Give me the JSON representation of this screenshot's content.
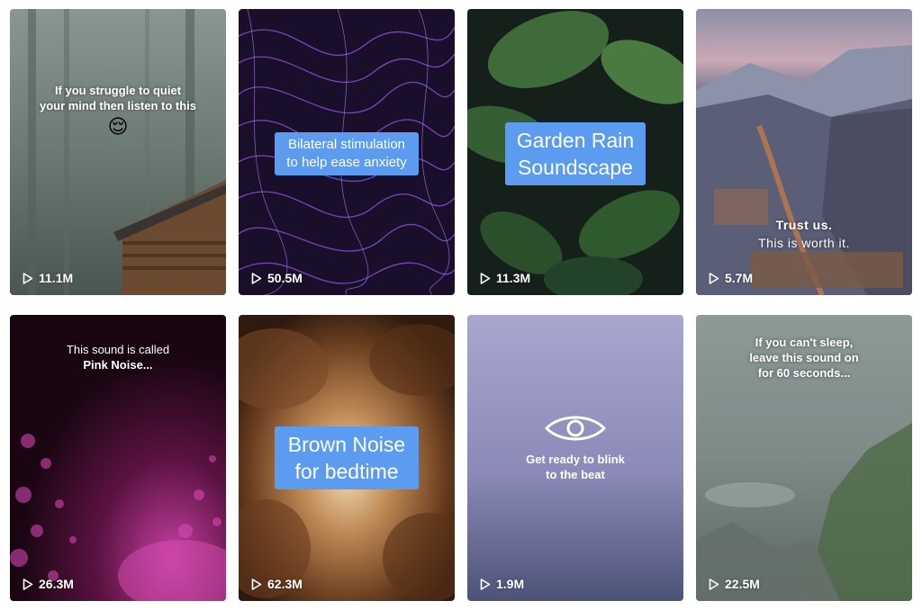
{
  "videos": [
    {
      "views": "11.1M",
      "caption": [
        "If you struggle to quiet",
        "your mind then listen to this"
      ],
      "emoji": "😌"
    },
    {
      "views": "50.5M",
      "caption": [
        "Bilateral stimulation",
        "to help ease anxiety"
      ]
    },
    {
      "views": "11.3M",
      "caption": [
        "Garden Rain",
        "Soundscape"
      ]
    },
    {
      "views": "5.7M",
      "caption": [
        "Trust us.",
        "This is worth it."
      ]
    },
    {
      "views": "26.3M",
      "caption": [
        "This sound is called",
        "Pink Noise..."
      ]
    },
    {
      "views": "62.3M",
      "caption": [
        "Brown Noise",
        "for bedtime"
      ]
    },
    {
      "views": "1.9M",
      "caption": [
        "Get ready to blink",
        "to the beat"
      ],
      "icon": "eye-icon"
    },
    {
      "views": "22.5M",
      "caption": [
        "If you can't sleep,",
        "leave this sound on",
        "for 60 seconds..."
      ]
    }
  ],
  "colors": {
    "caption_box": "#5b9cf0",
    "text": "#ffffff"
  }
}
